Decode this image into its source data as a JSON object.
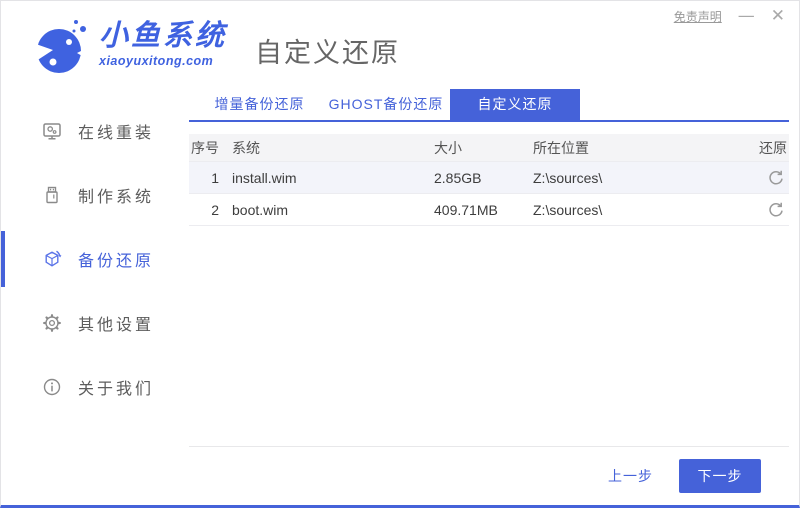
{
  "window": {
    "disclaimer": "免责声明",
    "minimize_glyph": "—",
    "close_glyph": "✕"
  },
  "brand": {
    "name": "小鱼系统",
    "domain": "xiaoyuxitong.com"
  },
  "page": {
    "title": "自定义还原"
  },
  "sidebar": {
    "items": [
      {
        "label": "在线重装",
        "icon": "monitor-icon",
        "active": false
      },
      {
        "label": "制作系统",
        "icon": "usb-icon",
        "active": false
      },
      {
        "label": "备份还原",
        "icon": "backup-cube-icon",
        "active": true
      },
      {
        "label": "其他设置",
        "icon": "gear-icon",
        "active": false
      },
      {
        "label": "关于我们",
        "icon": "info-icon",
        "active": false
      }
    ]
  },
  "tabs": [
    {
      "label": "增量备份还原",
      "active": false
    },
    {
      "label": "GHOST备份还原",
      "active": false
    },
    {
      "label": "自定义还原",
      "active": true
    }
  ],
  "table": {
    "headers": [
      "序号",
      "系统",
      "大小",
      "所在位置",
      "还原"
    ],
    "rows": [
      {
        "index": "1",
        "system": "install.wim",
        "size": "2.85GB",
        "location": "Z:\\sources\\"
      },
      {
        "index": "2",
        "system": "boot.wim",
        "size": "409.71MB",
        "location": "Z:\\sources\\"
      }
    ],
    "row_action_icon": "refresh-icon"
  },
  "footer": {
    "prev_label": "上一步",
    "next_label": "下一步"
  },
  "colors": {
    "accent": "#4562d9",
    "logo_blue": "#3f62e0",
    "table_header_bg": "#f4f4f6",
    "row_alt_bg": "#f3f4fa",
    "muted_text": "#999999"
  }
}
